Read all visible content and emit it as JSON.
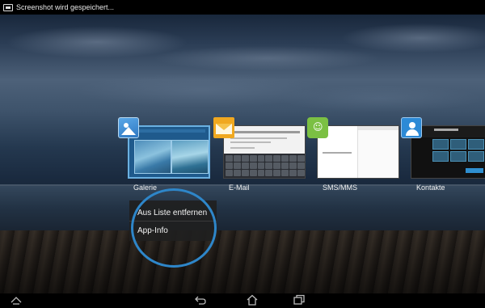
{
  "status_bar": {
    "notification_text": "Screenshot wird gespeichert..."
  },
  "recent_apps": [
    {
      "label": "Galerie",
      "icon": "gallery-icon"
    },
    {
      "label": "E-Mail",
      "icon": "email-icon"
    },
    {
      "label": "SMS/MMS",
      "icon": "sms-icon"
    },
    {
      "label": "Kontakte",
      "icon": "contacts-icon"
    }
  ],
  "context_menu": {
    "items": [
      {
        "label": "Aus Liste entfernen"
      },
      {
        "label": "App-Info"
      }
    ],
    "highlight_color": "#2e86c9"
  },
  "nav_bar": {
    "buttons": [
      "expand-up-icon",
      "back-icon",
      "home-icon",
      "recent-apps-icon"
    ]
  }
}
